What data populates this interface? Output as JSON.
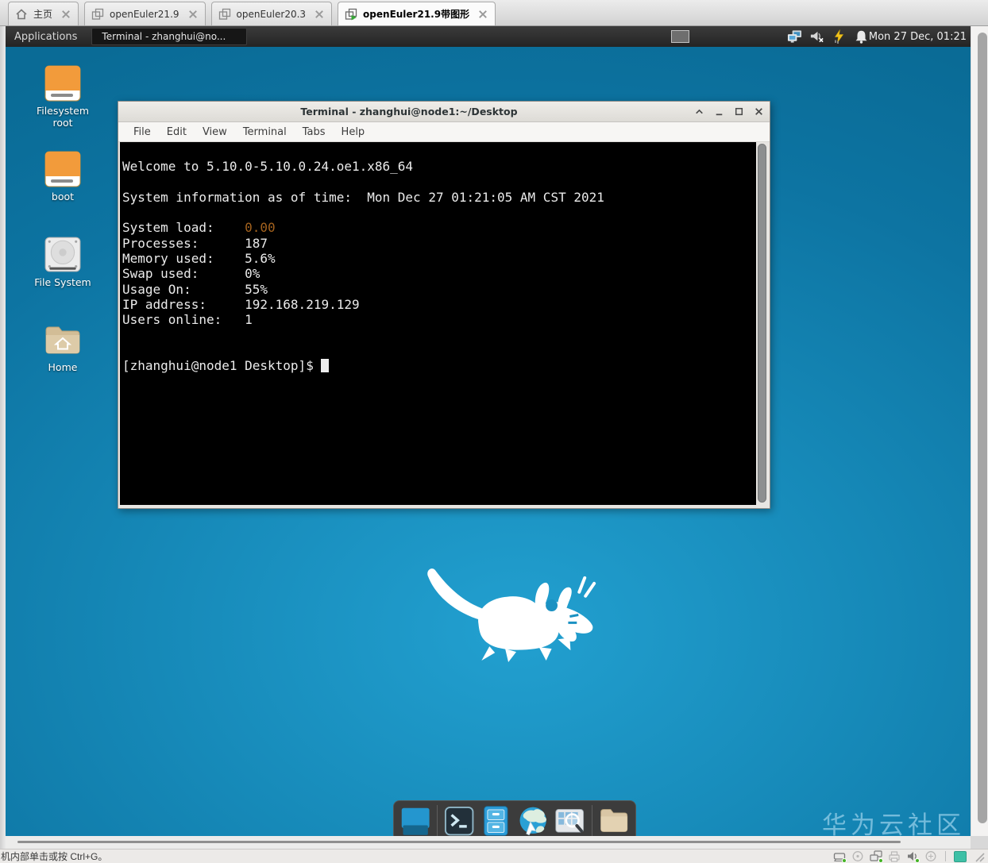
{
  "browser": {
    "tabs": [
      {
        "label": "主页",
        "icon": "home-icon",
        "active": false
      },
      {
        "label": "openEuler21.9",
        "icon": "vm-icon",
        "active": false
      },
      {
        "label": "openEuler20.3",
        "icon": "vm-icon",
        "active": false
      },
      {
        "label": "openEuler21.9带图形",
        "icon": "vm-play-icon",
        "active": true
      }
    ],
    "status_message": "机内部单击或按 Ctrl+G。",
    "status_devices": [
      {
        "icon": "harddisk-status-icon",
        "active": true
      },
      {
        "icon": "cdrom-status-icon",
        "active": false
      },
      {
        "icon": "network-status-icon",
        "active": true
      },
      {
        "icon": "printer-status-icon",
        "active": false
      },
      {
        "icon": "sound-status-icon",
        "active": true
      },
      {
        "icon": "usb-status-icon",
        "active": false
      }
    ]
  },
  "panel": {
    "applications_label": "Applications",
    "window_button_label": "Terminal - zhanghui@no...",
    "clock": "Mon 27 Dec, 01:21",
    "tray_icons": [
      "display-status-icon",
      "volume-muted-icon",
      "power-icon",
      "notifications-icon"
    ]
  },
  "desktop": {
    "icons": [
      {
        "label": "Filesystem root",
        "icon": "orange-drive-icon"
      },
      {
        "label": "boot",
        "icon": "orange-drive-icon"
      },
      {
        "label": "File System",
        "icon": "harddisk-icon"
      },
      {
        "label": "Home",
        "icon": "home-folder-icon"
      }
    ],
    "dock_items": [
      "show-desktop-icon",
      "separator",
      "terminal-icon",
      "file-manager-icon",
      "web-browser-icon",
      "app-finder-icon",
      "separator",
      "folder-icon"
    ],
    "watermark": "华为云社区"
  },
  "terminal": {
    "title": "Terminal - zhanghui@node1:~/Desktop",
    "menu": [
      "File",
      "Edit",
      "View",
      "Terminal",
      "Tabs",
      "Help"
    ],
    "welcome_line": "Welcome to 5.10.0-5.10.0.24.oe1.x86_64",
    "sysinfo_line": "System information as of time:  Mon Dec 27 01:21:05 AM CST 2021",
    "info_rows": [
      {
        "label": "System load:",
        "value": "0.00",
        "highlight": true
      },
      {
        "label": "Processes:",
        "value": "187",
        "highlight": false
      },
      {
        "label": "Memory used:",
        "value": "5.6%",
        "highlight": false
      },
      {
        "label": "Swap used:",
        "value": "0%",
        "highlight": false
      },
      {
        "label": "Usage On:",
        "value": "55%",
        "highlight": false
      },
      {
        "label": "IP address:",
        "value": "192.168.219.129",
        "highlight": false
      },
      {
        "label": "Users online:",
        "value": "1",
        "highlight": false
      }
    ],
    "prompt": "[zhanghui@node1 Desktop]$",
    "colors": {
      "background": "#000000",
      "foreground": "#ebebeb",
      "load_value": "#a3621e"
    }
  }
}
